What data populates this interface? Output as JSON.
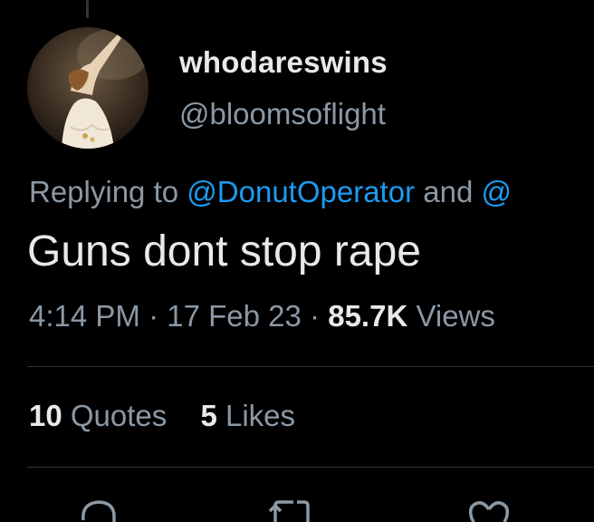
{
  "author": {
    "display_name": "whodareswins",
    "handle": "@bloomsoflight"
  },
  "reply": {
    "prefix": "Replying to",
    "mention1": "@DonutOperator",
    "connector": "and",
    "mention2": "@"
  },
  "tweet": {
    "text": "Guns dont stop rape",
    "time": "4:14 PM",
    "separator": "·",
    "date": "17 Feb 23",
    "views_count": "85.7K",
    "views_label": "Views"
  },
  "stats": {
    "quotes_count": "10",
    "quotes_label": "Quotes",
    "likes_count": "5",
    "likes_label": "Likes"
  },
  "colors": {
    "background": "#000000",
    "primary_text": "#e7e9ea",
    "secondary_text": "#8b98a5",
    "accent": "#1d9bf0",
    "divider": "#2f3336"
  },
  "icons": [
    "reply-icon",
    "retweet-icon",
    "like-icon"
  ]
}
